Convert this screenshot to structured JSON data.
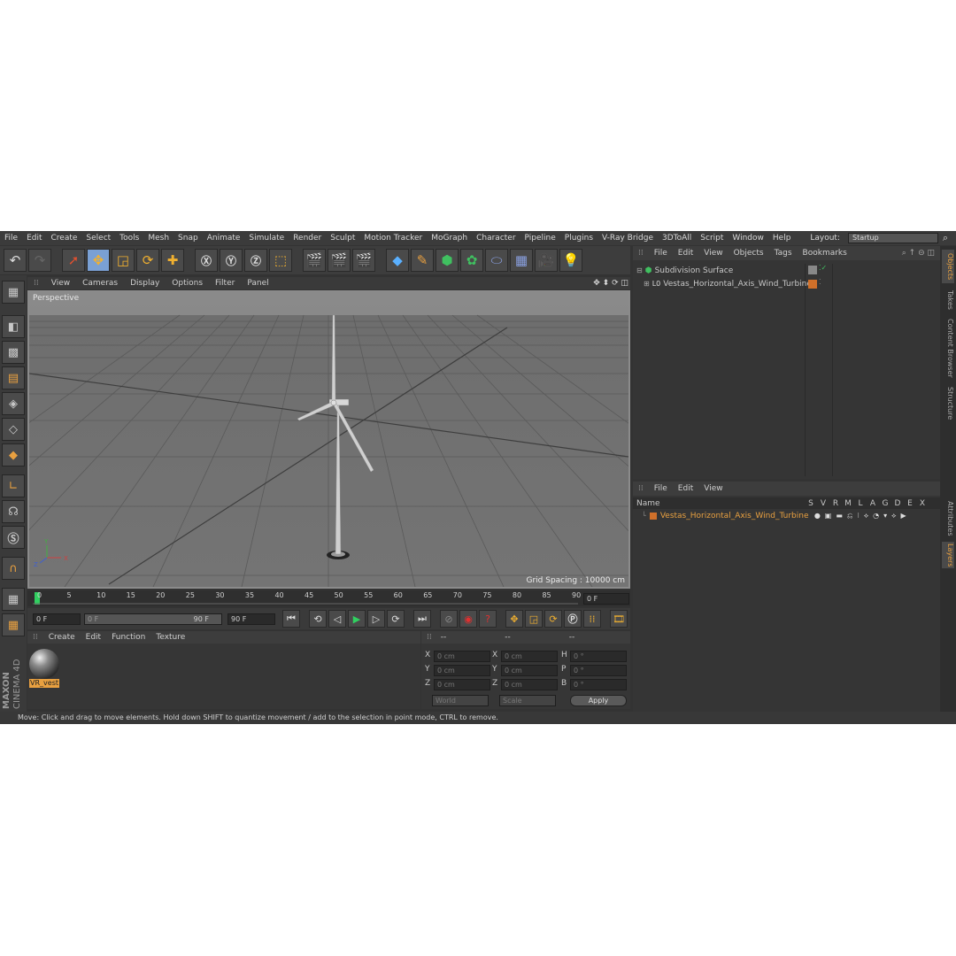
{
  "menu": [
    "File",
    "Edit",
    "Create",
    "Select",
    "Tools",
    "Mesh",
    "Snap",
    "Animate",
    "Simulate",
    "Render",
    "Sculpt",
    "Motion Tracker",
    "MoGraph",
    "Character",
    "Pipeline",
    "Plugins",
    "V-Ray Bridge",
    "3DToAll",
    "Script",
    "Window",
    "Help"
  ],
  "layout": {
    "label": "Layout:",
    "value": "Startup"
  },
  "viewport": {
    "menu": [
      "View",
      "Cameras",
      "Display",
      "Options",
      "Filter",
      "Panel"
    ],
    "camera_label": "Perspective",
    "grid_spacing": "Grid Spacing : 10000 cm",
    "axis": {
      "x": "X",
      "y": "Y",
      "z": "Z"
    }
  },
  "timeline": {
    "ticks": [
      "0",
      "5",
      "10",
      "15",
      "20",
      "25",
      "30",
      "35",
      "40",
      "45",
      "50",
      "55",
      "60",
      "65",
      "70",
      "75",
      "80",
      "85",
      "90"
    ],
    "current_frame": "0 F"
  },
  "transport": {
    "start": "0 F",
    "range_start": "0 F",
    "range_end": "90 F",
    "end": "90 F"
  },
  "material_manager": {
    "menu": [
      "Create",
      "Edit",
      "Function",
      "Texture"
    ],
    "material_name": "VR_vest"
  },
  "coordinates": {
    "header": [
      "--",
      "--",
      "--"
    ],
    "rows": [
      {
        "a": "X",
        "av": "0 cm",
        "b": "X",
        "bv": "0 cm",
        "c": "H",
        "cv": "0 °"
      },
      {
        "a": "Y",
        "av": "0 cm",
        "b": "Y",
        "bv": "0 cm",
        "c": "P",
        "cv": "0 °"
      },
      {
        "a": "Z",
        "av": "0 cm",
        "b": "Z",
        "bv": "0 cm",
        "c": "B",
        "cv": "0 °"
      }
    ],
    "mode": "World",
    "type": "Scale",
    "apply": "Apply"
  },
  "status": "Move: Click and drag to move elements. Hold down SHIFT to quantize movement / add to the selection in point mode, CTRL to remove.",
  "object_manager": {
    "menu": [
      "File",
      "Edit",
      "View",
      "Objects",
      "Tags",
      "Bookmarks"
    ],
    "objects": [
      {
        "name": "Subdivision Surface"
      },
      {
        "name": "Vestas_Horizontal_Axis_Wind_Turbine"
      }
    ]
  },
  "layer_manager": {
    "menu": [
      "File",
      "Edit",
      "View"
    ],
    "header_name": "Name",
    "columns": [
      "S",
      "V",
      "R",
      "M",
      "L",
      "A",
      "G",
      "D",
      "E",
      "X"
    ],
    "layers": [
      {
        "name": "Vestas_Horizontal_Axis_Wind_Turbine"
      }
    ]
  },
  "side_tabs": [
    "Objects",
    "Takes",
    "Content Browser",
    "Structure",
    "Attributes",
    "Layers"
  ],
  "brand": {
    "line1": "MAXON",
    "line2": "CINEMA 4D"
  },
  "colors": {
    "accent": "#e8a040",
    "selected_tool": "#7aa0d4",
    "layer_orange": "#d0702a"
  }
}
